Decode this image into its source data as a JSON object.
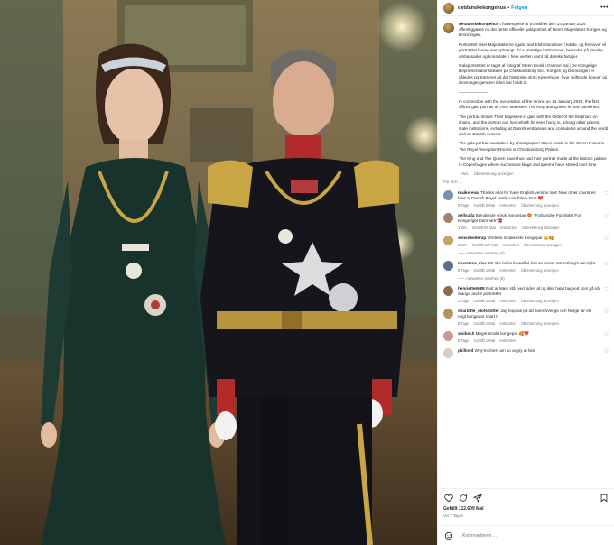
{
  "post": {
    "username": "detdanskekongehus",
    "follow_label": "Folgen",
    "caption": {
      "paragraphs": [
        "I forlængelse af tronskiftet den 14. januar 2024 offentliggøres nu det første officielle galaportræt af Deres Majestæter Kongen og Dronningen.",
        "Portrættet viser Majestæterne i gala med Elefantordenen i kæde, og fremover vil portrættet kunne ses ophængt i bl.a. statslige institutioner, herunder på danske ambassader og konsulater i hele verden samt på danske fartøjer.",
        "Galaportrættet er taget af fotograf Steen Evald i Grønne Sal i De Kongelige Repræsentationslokaler på Christiansborg Slot. Kongen og Dronningen er således portrætteret på det historiske slot i København, hvor skiftende konger og dronninger gennem tiden har holdt til.",
        "———————",
        "In connection with the succession of the throne on 14 January 2024, the first official gala portrait of Their Majesties The King and Queen is now published.",
        "The portrait shows Their Majesties in gala with the Order of the Elephant on chains, and the portrait can henceforth be seen hung in, among other places, state institutions, including at Danish embassies and consulates around the world and on Danish vessels.",
        "The gala portrait was taken by photographer Steen Evald in the Green Room in The Royal Reception Rooms at Christiansborg Palace.",
        "The King and The Queen have thus had their portrait made at the historic palace in Copenhagen where successive kings and queens have stayed over time."
      ],
      "time": "1 Wo.",
      "translate": "Übersetzung anzeigen"
    },
    "translate_label": "Für dich ⌄",
    "comments": [
      {
        "user": "maikereuw",
        "text": "Thanks a lot for have English version too!! Now other countries fans of Danish Royal family can follow too!! ❤️",
        "time": "6 Tage",
        "likes": "Gefällt 5 Mal",
        "reply": "Antworten",
        "translate": "Übersetzung anzeigen",
        "color": "#7c8fb0",
        "replies": ""
      },
      {
        "user": "dellsada",
        "text": "Blendende smukt kongepar 😍 \"Forbundne Forpligtet For Kongeriget Danmark\"🇩🇰",
        "time": "1 Wo.",
        "likes": "Gefällt 98 Mal",
        "reply": "Antworten",
        "translate": "Übersetzung anzeigen",
        "color": "#a0826d",
        "replies": ""
      },
      {
        "user": "simonkellerup",
        "text": "Verdens smukkeste Kongepar 👑🥰",
        "time": "1 Wo.",
        "likes": "Gefällt 187 Mal",
        "reply": "Antworten",
        "translate": "Übersetzung anzeigen",
        "color": "#c7a26b",
        "replies": "—— Antworten ansehen (4)"
      },
      {
        "user": "newstone_rise",
        "text": "Oh she looks beautiful, but so tense! Something's not right.",
        "time": "6 Tage",
        "likes": "Gefällt 1 Mal",
        "reply": "Antworten",
        "translate": "Übersetzung anzeigen",
        "color": "#5a6f8e",
        "replies": "—— Antworten ansehen (5)"
      },
      {
        "user": "henriette9988",
        "text": "Rart at Mary står ved siden af og ikke halvt bagved som på så mange andre portrætter",
        "time": "3 Tage",
        "likes": "Gefällt 2 Mal",
        "reply": "Antworten",
        "translate": "Übersetzung anzeigen",
        "color": "#8f6a4a",
        "replies": ""
      },
      {
        "user": "charlotte_olofsdotter",
        "text": "Jag hoppas på att även Sverige och Norge får ett ungt kungapar snart !!",
        "time": "5 Tage",
        "likes": "Gefällt 1 Mal",
        "reply": "Antworten",
        "translate": "Übersetzung anzeigen",
        "color": "#b5935c",
        "replies": ""
      },
      {
        "user": "vivibech",
        "text": "Meget smukt kongepar 🥰❤️",
        "time": "5 Tage",
        "likes": "Gefällt 1 Mal",
        "reply": "Antworten",
        "translate": "",
        "color": "#c99a8c",
        "replies": ""
      },
      {
        "user": "pkillovd",
        "text": "Why're chest am so angry at him",
        "time": "",
        "likes": "",
        "reply": "",
        "translate": "",
        "color": "#d6d0c4",
        "replies": ""
      }
    ],
    "likes_count": "Gefällt 112.609 Mal",
    "date": "Vor 7 Tagen",
    "add_comment_placeholder": "Kommentieren ..."
  },
  "colors": {
    "link": "#0095f6",
    "muted": "#737373",
    "text": "#262626"
  }
}
